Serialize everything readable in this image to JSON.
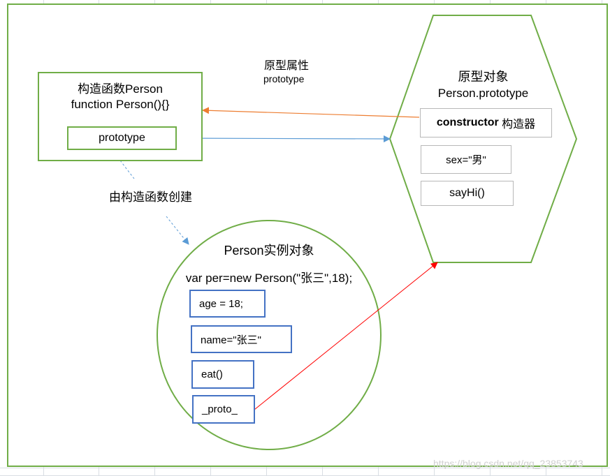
{
  "colors": {
    "frame": "#70ad47",
    "blue_box": "#4472c4",
    "arrow_orange": "#ed7d31",
    "arrow_blue": "#5b9bd5",
    "arrow_red": "#ff0000",
    "grid": "#d9dee4"
  },
  "labels": {
    "prototype_property_title": "原型属性",
    "prototype_property_sub": "prototype",
    "created_by_constructor": "由构造函数创建"
  },
  "constructor": {
    "title": "构造函数Person",
    "code": "function Person(){}",
    "prototype_field": "prototype"
  },
  "prototype_object": {
    "title": "原型对象",
    "name": "Person.prototype",
    "constructor_bold": "constructor",
    "constructor_text": " 构造器",
    "sex": "sex=\"男\"",
    "sayhi": "sayHi()"
  },
  "instance": {
    "title": "Person实例对象",
    "code": "var per=new Person(\"张三\",18);",
    "age": "age = 18;",
    "name": "name=\"张三\"",
    "eat": "eat()",
    "proto": "_proto_"
  },
  "watermark": "https://blog.csdn.net/qq_23853743"
}
